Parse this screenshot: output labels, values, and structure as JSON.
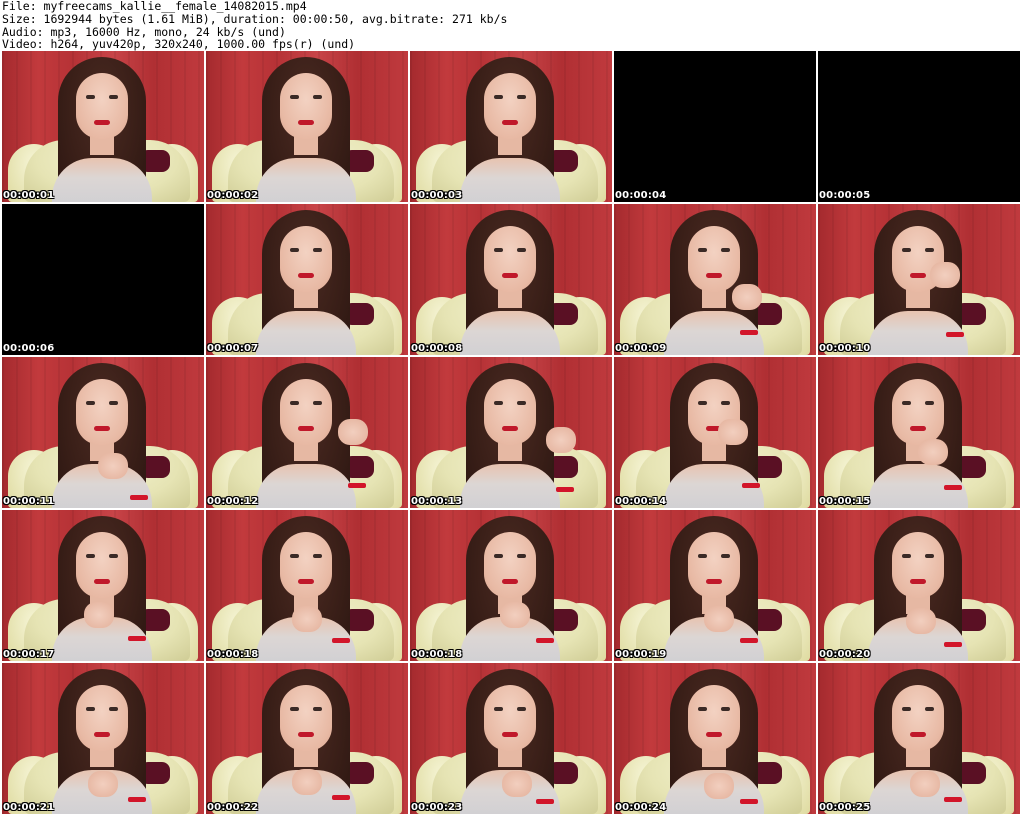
{
  "header": {
    "file": "File: myfreecams_kallie__female_14082015.mp4",
    "size": "Size: 1692944 bytes (1.61 MiB), duration: 00:00:50, avg.bitrate: 271 kb/s",
    "audio": "Audio: mp3, 16000 Hz, mono, 24 kb/s (und)",
    "video": "Video: h264, yuv420p, 320x240, 1000.00 fps(r) (und)"
  },
  "thumbnails": [
    {
      "timestamp": "00:00:01",
      "frame": "person"
    },
    {
      "timestamp": "00:00:02",
      "frame": "person"
    },
    {
      "timestamp": "00:00:03",
      "frame": "person"
    },
    {
      "timestamp": "00:00:04",
      "frame": "black"
    },
    {
      "timestamp": "00:00:05",
      "frame": "black"
    },
    {
      "timestamp": "00:00:06",
      "frame": "black"
    },
    {
      "timestamp": "00:00:07",
      "frame": "person"
    },
    {
      "timestamp": "00:00:08",
      "frame": "person"
    },
    {
      "timestamp": "00:00:09",
      "frame": "person-hand"
    },
    {
      "timestamp": "00:00:10",
      "frame": "person-hand"
    },
    {
      "timestamp": "00:00:11",
      "frame": "person-hand"
    },
    {
      "timestamp": "00:00:12",
      "frame": "person-hand"
    },
    {
      "timestamp": "00:00:13",
      "frame": "person-hand"
    },
    {
      "timestamp": "00:00:14",
      "frame": "person-hand"
    },
    {
      "timestamp": "00:00:15",
      "frame": "person-hand"
    },
    {
      "timestamp": "00:00:17",
      "frame": "person-hand"
    },
    {
      "timestamp": "00:00:18",
      "frame": "person-hand"
    },
    {
      "timestamp": "00:00:18",
      "frame": "person-hand"
    },
    {
      "timestamp": "00:00:19",
      "frame": "person-hand"
    },
    {
      "timestamp": "00:00:20",
      "frame": "person-hand"
    },
    {
      "timestamp": "00:00:21",
      "frame": "person-hand"
    },
    {
      "timestamp": "00:00:22",
      "frame": "person-hand"
    },
    {
      "timestamp": "00:00:23",
      "frame": "person-hand"
    },
    {
      "timestamp": "00:00:24",
      "frame": "person-hand"
    },
    {
      "timestamp": "00:00:25",
      "frame": "person-hand"
    }
  ]
}
